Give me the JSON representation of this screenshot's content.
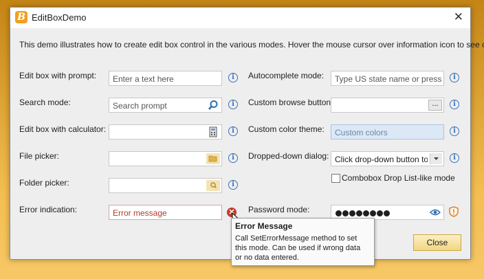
{
  "window": {
    "title": "EditBoxDemo"
  },
  "description": "This demo illustrates how to create edit box control in the various modes. Hover the mouse cursor over information icon to see control",
  "left_column": {
    "prompt_label": "Edit box with prompt:",
    "prompt_placeholder": "Enter a text here",
    "search_label": "Search mode:",
    "search_placeholder": "Search prompt",
    "calculator_label": "Edit box with calculator:",
    "calculator_value": "",
    "file_label": "File picker:",
    "file_value": "",
    "folder_label": "Folder picker:",
    "folder_value": "",
    "error_label": "Error indication:",
    "error_value": "Error message"
  },
  "right_column": {
    "autocomplete_label": "Autocomplete mode:",
    "autocomplete_placeholder": "Type US state name or press D...",
    "browse_label": "Custom browse button:",
    "browse_button_text": "...",
    "browse_value": "",
    "color_theme_label": "Custom color theme:",
    "color_theme_value": "Custom colors",
    "dropdown_label": "Dropped-down dialog:",
    "dropdown_value": "Click drop-down button to ...",
    "combobox_checkbox_label": "Combobox Drop List-like mode",
    "combobox_checked": false,
    "password_label": "Password mode:",
    "password_dot_count": 8
  },
  "tooltip": {
    "title": "Error Message",
    "line1": "Call SetErrorMessage method to set",
    "line2": "this mode. Can be used if wrong data",
    "line3": "or no data entered."
  },
  "close_button": "Close",
  "colors": {
    "accent_info": "#3a72b8",
    "error": "#c43a2a",
    "custom_theme_bg": "#dce8f6",
    "close_button": "#f2d682"
  }
}
